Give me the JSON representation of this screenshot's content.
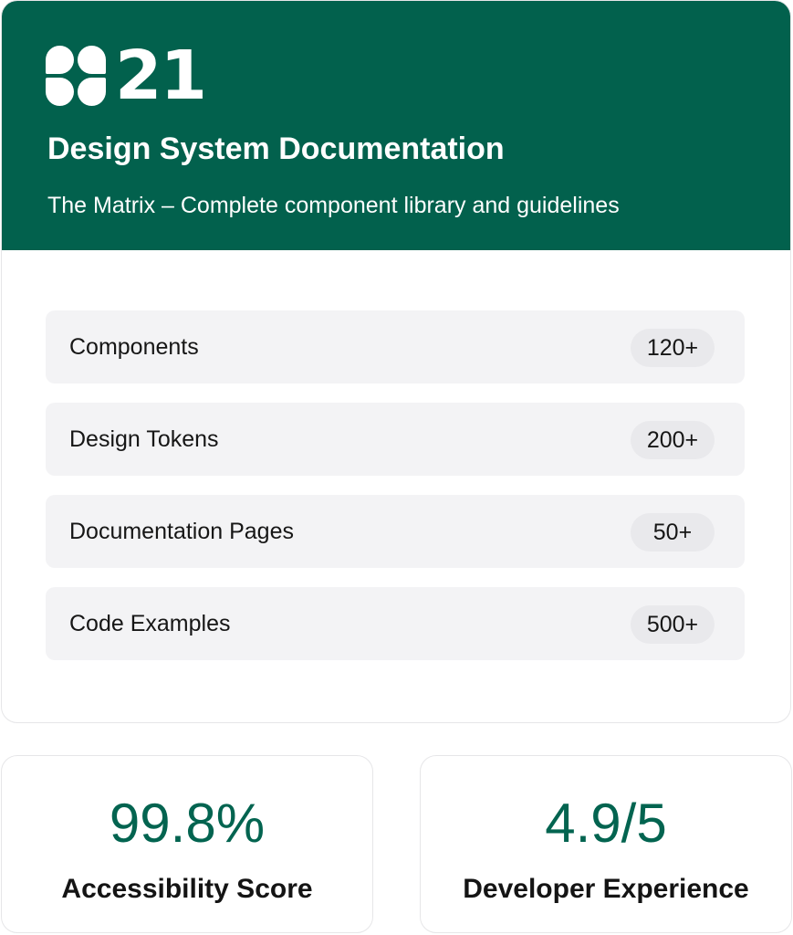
{
  "brand": {
    "logo_icon": "four-petal-grid-icon",
    "logo_number": "21",
    "color": "#02614d",
    "accent": "#036450"
  },
  "header": {
    "title": "Design System Documentation",
    "subtitle": "The Matrix – Complete component library and guidelines"
  },
  "stats": [
    {
      "label": "Components",
      "count": "120+"
    },
    {
      "label": "Design Tokens",
      "count": "200+"
    },
    {
      "label": "Documentation Pages",
      "count": "50+"
    },
    {
      "label": "Code Examples",
      "count": "500+"
    }
  ],
  "metrics": [
    {
      "value": "99.8%",
      "label": "Accessibility Score"
    },
    {
      "value": "4.9/5",
      "label": "Developer Experience"
    }
  ]
}
